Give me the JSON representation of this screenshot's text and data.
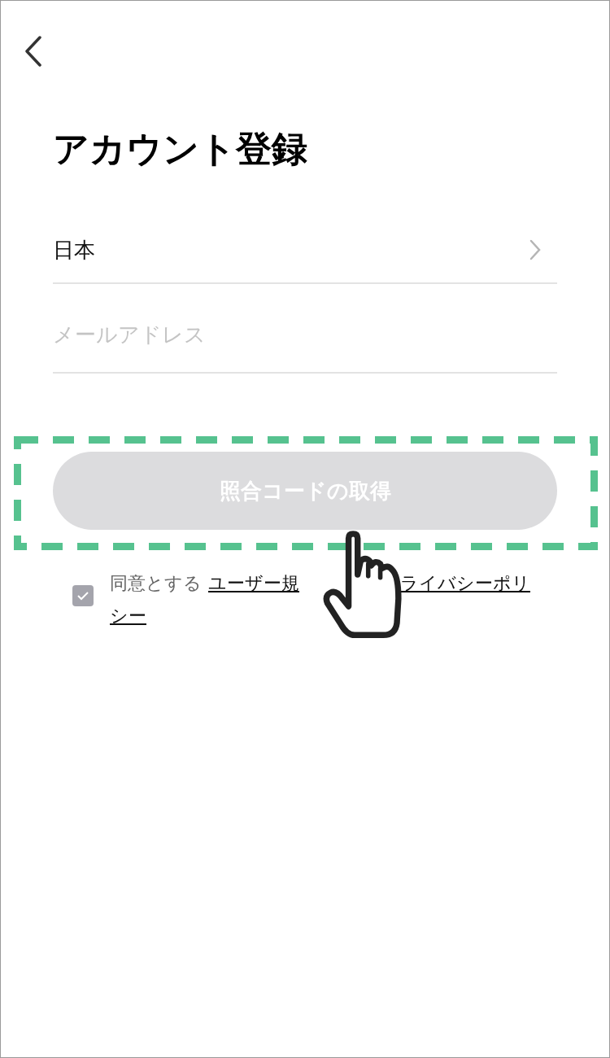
{
  "header": {
    "title": "アカウント登録"
  },
  "country": {
    "value": "日本"
  },
  "email": {
    "placeholder": "メールアドレス"
  },
  "submit": {
    "label": "照合コードの取得",
    "disabled": true,
    "highlighted": true
  },
  "consent": {
    "checked": true,
    "text": "同意とする",
    "links": [
      "ユーザー規",
      "ライバシーポリ",
      "シー"
    ]
  }
}
